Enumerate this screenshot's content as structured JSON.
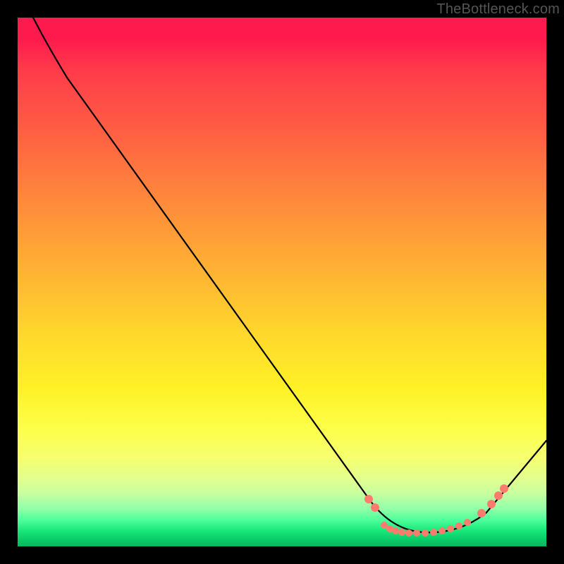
{
  "watermark": "TheBottleneck.com",
  "colors": {
    "frame": "#000000",
    "curve": "#000000",
    "markers": "#ff7b6e",
    "gradient_top": "#ff1a4d",
    "gradient_mid": "#ffd82c",
    "gradient_bottom": "#04b85c",
    "watermark": "#555555"
  },
  "chart_data": {
    "type": "line",
    "title": "",
    "xlabel": "",
    "ylabel": "",
    "xlim": [
      0,
      100
    ],
    "ylim": [
      0,
      100
    ],
    "grid": false,
    "series": [
      {
        "name": "bottleneck-curve",
        "x": [
          3,
          9,
          20,
          30,
          40,
          50,
          60,
          66,
          70,
          74,
          78,
          82,
          86,
          90,
          95,
          100
        ],
        "y": [
          100,
          89,
          73,
          58,
          44,
          30,
          15,
          8,
          5,
          3,
          2,
          3,
          5,
          8,
          14,
          20
        ]
      }
    ],
    "annotations": [
      {
        "text": "TheBottleneck.com",
        "position": "top-right"
      }
    ],
    "marker_region_x": [
      66,
      92
    ]
  }
}
